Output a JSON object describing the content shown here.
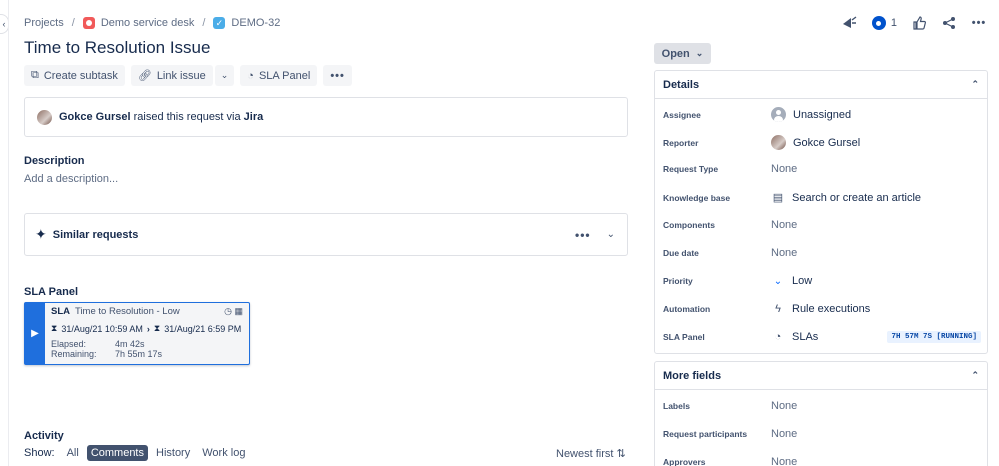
{
  "breadcrumb": {
    "root": "Projects",
    "project": "Demo service desk",
    "issue_key": "DEMO-32"
  },
  "header_actions": {
    "watchers_count": "1"
  },
  "issue": {
    "title": "Time to Resolution Issue"
  },
  "toolbar": {
    "create_subtask": "Create subtask",
    "link_issue": "Link issue",
    "sla_panel": "SLA Panel"
  },
  "raised": {
    "user": "Gokce Gursel",
    "text": "raised this request via",
    "channel": "Jira"
  },
  "description": {
    "heading": "Description",
    "placeholder": "Add a description..."
  },
  "similar": {
    "label": "Similar requests"
  },
  "sla_panel": {
    "heading": "SLA Panel",
    "tag": "SLA",
    "name": "Time to Resolution - Low",
    "start": "31/Aug/21 10:59 AM",
    "end": "31/Aug/21 6:59 PM",
    "elapsed_label": "Elapsed:",
    "elapsed_value": "4m 42s",
    "remaining_label": "Remaining:",
    "remaining_value": "7h 55m 17s"
  },
  "activity": {
    "heading": "Activity",
    "show_label": "Show:",
    "filters": [
      "All",
      "Comments",
      "History",
      "Work log"
    ],
    "active_filter": "Comments",
    "sort": "Newest first"
  },
  "status": {
    "label": "Open"
  },
  "details": {
    "heading": "Details",
    "fields": {
      "assignee": {
        "label": "Assignee",
        "value": "Unassigned"
      },
      "reporter": {
        "label": "Reporter",
        "value": "Gokce Gursel"
      },
      "request_type": {
        "label": "Request Type",
        "value": "None"
      },
      "knowledge_base": {
        "label": "Knowledge base",
        "value": "Search or create an article"
      },
      "components": {
        "label": "Components",
        "value": "None"
      },
      "due_date": {
        "label": "Due date",
        "value": "None"
      },
      "priority": {
        "label": "Priority",
        "value": "Low"
      },
      "automation": {
        "label": "Automation",
        "value": "Rule executions"
      },
      "sla_panel": {
        "label": "SLA Panel",
        "value": "SLAs",
        "badge": "7H 57M 7S [RUNNING]"
      }
    }
  },
  "more_fields": {
    "heading": "More fields",
    "fields": {
      "labels": {
        "label": "Labels",
        "value": "None"
      },
      "participants": {
        "label": "Request participants",
        "value": "None"
      },
      "approvers": {
        "label": "Approvers",
        "value": "None"
      }
    }
  },
  "colors": {
    "accent": "#1f6fdd",
    "text": "#172b4d",
    "muted": "#5e6c84",
    "border": "#dfe1e6",
    "priority_low": "#0065ff"
  }
}
